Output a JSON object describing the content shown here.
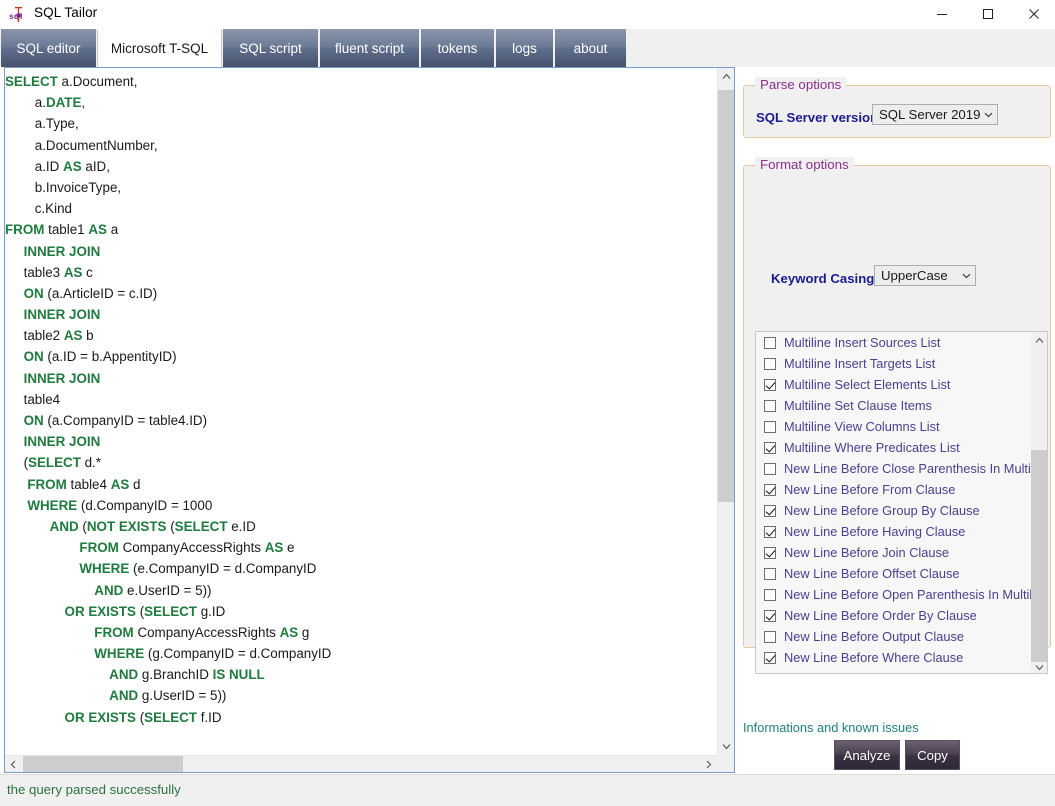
{
  "window": {
    "title": "SQL Tailor",
    "icon": "sql-needle-icon",
    "minimize_label": "—",
    "maximize_label": "□",
    "close_label": "✕"
  },
  "tabs": [
    {
      "label": "SQL editor",
      "active": false
    },
    {
      "label": "Microsoft T-SQL",
      "active": true
    },
    {
      "label": "SQL script",
      "active": false
    },
    {
      "label": "fluent script",
      "active": false
    },
    {
      "label": "tokens",
      "active": false
    },
    {
      "label": "logs",
      "active": false
    },
    {
      "label": "about",
      "active": false
    }
  ],
  "editor": {
    "lines": [
      [
        {
          "t": "SELECT",
          "k": true
        },
        {
          "t": " a.Document,",
          "k": false
        }
      ],
      [
        {
          "t": "        a.",
          "k": false
        },
        {
          "t": "DATE",
          "k": true
        },
        {
          "t": ",",
          "k": false
        }
      ],
      [
        {
          "t": "        a.Type,",
          "k": false
        }
      ],
      [
        {
          "t": "        a.DocumentNumber,",
          "k": false
        }
      ],
      [
        {
          "t": "        a.ID ",
          "k": false
        },
        {
          "t": "AS",
          "k": true
        },
        {
          "t": " aID,",
          "k": false
        }
      ],
      [
        {
          "t": "        b.InvoiceType,",
          "k": false
        }
      ],
      [
        {
          "t": "        c.Kind",
          "k": false
        }
      ],
      [
        {
          "t": "FROM",
          "k": true
        },
        {
          "t": " table1 ",
          "k": false
        },
        {
          "t": "AS",
          "k": true
        },
        {
          "t": " a",
          "k": false
        }
      ],
      [
        {
          "t": "     ",
          "k": false
        },
        {
          "t": "INNER JOIN",
          "k": true
        }
      ],
      [
        {
          "t": "     table3 ",
          "k": false
        },
        {
          "t": "AS",
          "k": true
        },
        {
          "t": " c",
          "k": false
        }
      ],
      [
        {
          "t": "     ",
          "k": false
        },
        {
          "t": "ON",
          "k": true
        },
        {
          "t": " (a.ArticleID = c.ID)",
          "k": false
        }
      ],
      [
        {
          "t": "     ",
          "k": false
        },
        {
          "t": "INNER JOIN",
          "k": true
        }
      ],
      [
        {
          "t": "     table2 ",
          "k": false
        },
        {
          "t": "AS",
          "k": true
        },
        {
          "t": " b",
          "k": false
        }
      ],
      [
        {
          "t": "     ",
          "k": false
        },
        {
          "t": "ON",
          "k": true
        },
        {
          "t": " (a.ID = b.AppentityID)",
          "k": false
        }
      ],
      [
        {
          "t": "     ",
          "k": false
        },
        {
          "t": "INNER JOIN",
          "k": true
        }
      ],
      [
        {
          "t": "     table4",
          "k": false
        }
      ],
      [
        {
          "t": "     ",
          "k": false
        },
        {
          "t": "ON",
          "k": true
        },
        {
          "t": " (a.CompanyID = table4.ID)",
          "k": false
        }
      ],
      [
        {
          "t": "     ",
          "k": false
        },
        {
          "t": "INNER JOIN",
          "k": true
        }
      ],
      [
        {
          "t": "     (",
          "k": false
        },
        {
          "t": "SELECT",
          "k": true
        },
        {
          "t": " d.*",
          "k": false
        }
      ],
      [
        {
          "t": "      ",
          "k": false
        },
        {
          "t": "FROM",
          "k": true
        },
        {
          "t": " table4 ",
          "k": false
        },
        {
          "t": "AS",
          "k": true
        },
        {
          "t": " d",
          "k": false
        }
      ],
      [
        {
          "t": "      ",
          "k": false
        },
        {
          "t": "WHERE",
          "k": true
        },
        {
          "t": " (d.CompanyID = 1000",
          "k": false
        }
      ],
      [
        {
          "t": "            ",
          "k": false
        },
        {
          "t": "AND",
          "k": true
        },
        {
          "t": " (",
          "k": false
        },
        {
          "t": "NOT EXISTS",
          "k": true
        },
        {
          "t": " (",
          "k": false
        },
        {
          "t": "SELECT",
          "k": true
        },
        {
          "t": " e.ID",
          "k": false
        }
      ],
      [
        {
          "t": "                    ",
          "k": false
        },
        {
          "t": "FROM",
          "k": true
        },
        {
          "t": " CompanyAccessRights ",
          "k": false
        },
        {
          "t": "AS",
          "k": true
        },
        {
          "t": " e",
          "k": false
        }
      ],
      [
        {
          "t": "                    ",
          "k": false
        },
        {
          "t": "WHERE",
          "k": true
        },
        {
          "t": " (e.CompanyID = d.CompanyID",
          "k": false
        }
      ],
      [
        {
          "t": "                        ",
          "k": false
        },
        {
          "t": "AND",
          "k": true
        },
        {
          "t": " e.UserID = 5))",
          "k": false
        }
      ],
      [
        {
          "t": "                ",
          "k": false
        },
        {
          "t": "OR EXISTS",
          "k": true
        },
        {
          "t": " (",
          "k": false
        },
        {
          "t": "SELECT",
          "k": true
        },
        {
          "t": " g.ID",
          "k": false
        }
      ],
      [
        {
          "t": "                        ",
          "k": false
        },
        {
          "t": "FROM",
          "k": true
        },
        {
          "t": " CompanyAccessRights ",
          "k": false
        },
        {
          "t": "AS",
          "k": true
        },
        {
          "t": " g",
          "k": false
        }
      ],
      [
        {
          "t": "                        ",
          "k": false
        },
        {
          "t": "WHERE",
          "k": true
        },
        {
          "t": " (g.CompanyID = d.CompanyID",
          "k": false
        }
      ],
      [
        {
          "t": "                            ",
          "k": false
        },
        {
          "t": "AND",
          "k": true
        },
        {
          "t": " g.BranchID ",
          "k": false
        },
        {
          "t": "IS NULL",
          "k": true
        }
      ],
      [
        {
          "t": "                            ",
          "k": false
        },
        {
          "t": "AND",
          "k": true
        },
        {
          "t": " g.UserID = 5))",
          "k": false
        }
      ],
      [
        {
          "t": "                ",
          "k": false
        },
        {
          "t": "OR EXISTS",
          "k": true
        },
        {
          "t": " (",
          "k": false
        },
        {
          "t": "SELECT",
          "k": true
        },
        {
          "t": " f.ID",
          "k": false
        }
      ]
    ],
    "scroll_up_glyph": "▲",
    "scroll_down_glyph": "▼",
    "scroll_left_glyph": "❮",
    "scroll_right_glyph": "❯"
  },
  "parse_options": {
    "group_title": "Parse options",
    "sql_server_version_label": "SQL Server version",
    "sql_server_version_value": "SQL Server 2019"
  },
  "format_options": {
    "group_title": "Format options",
    "keyword_casing_label": "Keyword Casing",
    "keyword_casing_value": "UpperCase",
    "items": [
      {
        "label": "Multiline Insert Sources List",
        "checked": false
      },
      {
        "label": "Multiline Insert Targets List",
        "checked": false
      },
      {
        "label": "Multiline Select Elements List",
        "checked": true
      },
      {
        "label": "Multiline Set Clause Items",
        "checked": false
      },
      {
        "label": "Multiline View Columns List",
        "checked": false
      },
      {
        "label": "Multiline Where Predicates List",
        "checked": true
      },
      {
        "label": "New Line Before Close Parenthesis In Multiline",
        "checked": false
      },
      {
        "label": "New Line Before From Clause",
        "checked": true
      },
      {
        "label": "New Line Before Group By Clause",
        "checked": true
      },
      {
        "label": "New Line Before Having Clause",
        "checked": true
      },
      {
        "label": "New Line Before Join Clause",
        "checked": true
      },
      {
        "label": "New Line Before Offset Clause",
        "checked": false
      },
      {
        "label": "New Line Before Open Parenthesis In Multiline",
        "checked": false
      },
      {
        "label": "New Line Before Order By Clause",
        "checked": true
      },
      {
        "label": "New Line Before Output Clause",
        "checked": false
      },
      {
        "label": "New Line Before Where Clause",
        "checked": true
      }
    ]
  },
  "actions": {
    "info_link": "Informations and known issues",
    "analyze_label": "Analyze",
    "copy_label": "Copy"
  },
  "statusbar": {
    "message": "the query parsed successfully"
  },
  "colors": {
    "accent_group": "#8c2f8c",
    "label_blue": "#1b1b8f",
    "option_text": "#4b3f8f",
    "keyword_green": "#1f7a3d",
    "status_green": "#2f6f3f",
    "link_teal": "#1f7f7f",
    "tab_blue_dark": "#46526c"
  }
}
